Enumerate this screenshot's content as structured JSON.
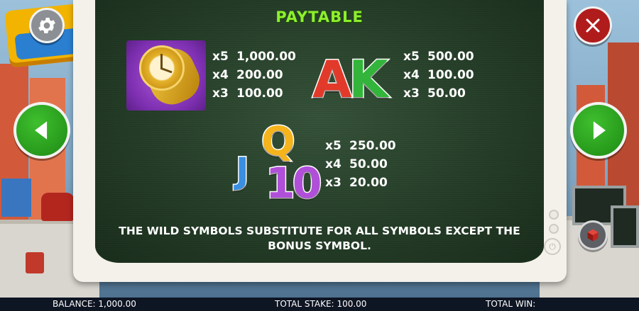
{
  "header": {
    "title": "PAYTABLE"
  },
  "controls": {
    "settings_icon": "gear-icon",
    "close_icon": "close-icon",
    "prev_icon": "triangle-left-icon",
    "next_icon": "triangle-right-icon",
    "cube_icon": "cube-icon"
  },
  "symbols": {
    "watch": {
      "icon": "gold-watch-icon",
      "pays": [
        {
          "count": "x5",
          "value": "1,000.00"
        },
        {
          "count": "x4",
          "value": "200.00"
        },
        {
          "count": "x3",
          "value": "100.00"
        }
      ]
    },
    "ak": {
      "letters": [
        "A",
        "K"
      ],
      "pays": [
        {
          "count": "x5",
          "value": "500.00"
        },
        {
          "count": "x4",
          "value": "100.00"
        },
        {
          "count": "x3",
          "value": "50.00"
        }
      ]
    },
    "jq10": {
      "letters": [
        "Q",
        "J",
        "10"
      ],
      "pays": [
        {
          "count": "x5",
          "value": "250.00"
        },
        {
          "count": "x4",
          "value": "50.00"
        },
        {
          "count": "x3",
          "value": "20.00"
        }
      ]
    }
  },
  "note": {
    "line1": "THE WILD SYMBOLS SUBSTITUTE FOR ALL SYMBOLS EXCEPT THE",
    "line2": "BONUS SYMBOL."
  },
  "status_bar": {
    "balance_label": "BALANCE:",
    "balance_value": "1,000.00",
    "stake_label": "TOTAL STAKE:",
    "stake_value": "100.00",
    "win_label": "TOTAL WIN:",
    "win_value": ""
  },
  "colors": {
    "title": "#8df02b",
    "letter_a": "#e23a2a",
    "letter_k": "#32b53a",
    "letter_q": "#f5b41c",
    "letter_j": "#3a8fe0",
    "letter_10": "#b04fd8",
    "nav_green": "#1d8a14",
    "close_red": "#b01c1c"
  }
}
